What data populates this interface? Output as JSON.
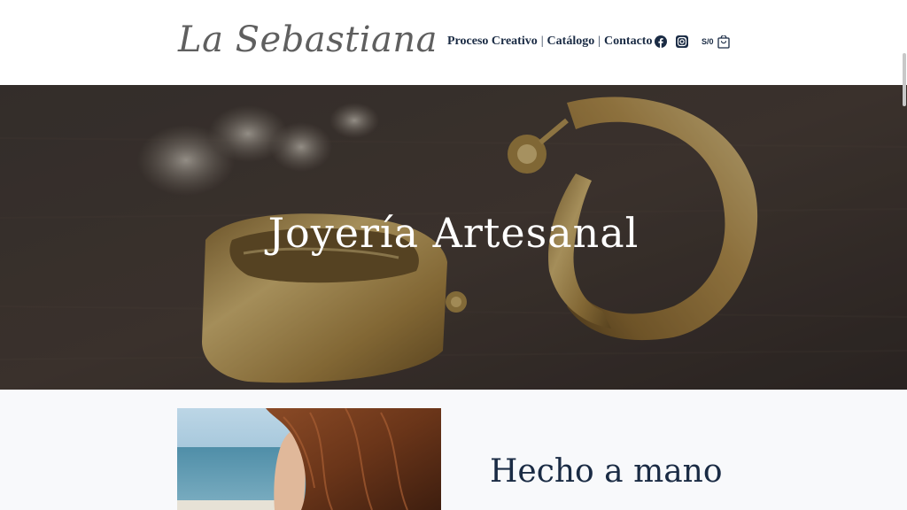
{
  "brand": {
    "name": "La Sebastiana"
  },
  "nav": {
    "items": [
      {
        "label": "Proceso Creativo"
      },
      {
        "label": "Catálogo"
      },
      {
        "label": "Contacto"
      }
    ],
    "separator": "|"
  },
  "header_icons": {
    "facebook": "facebook-icon",
    "instagram": "instagram-icon",
    "cart": "cart-icon"
  },
  "cart": {
    "currency_label": "S/0"
  },
  "hero": {
    "title": "Joyería Artesanal"
  },
  "section": {
    "heading": "Hecho a mano"
  },
  "colors": {
    "navy": "#1a2b44",
    "logo_gray": "#5f5f5f",
    "gold": "#c9a654",
    "hero_bg": "#3a322e"
  }
}
